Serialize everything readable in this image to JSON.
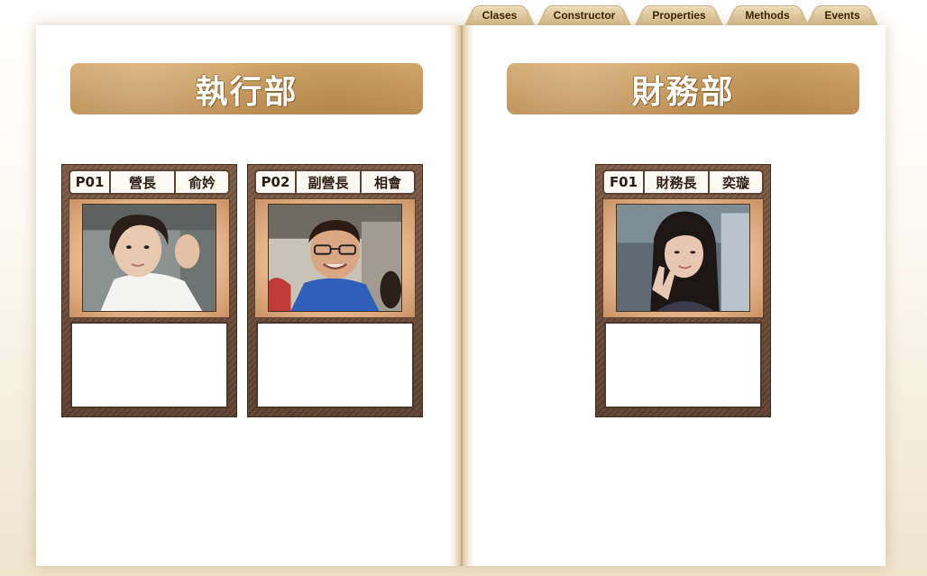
{
  "tabs": [
    {
      "label": "Clases"
    },
    {
      "label": "Constructor"
    },
    {
      "label": "Properties"
    },
    {
      "label": "Methods"
    },
    {
      "label": "Events"
    }
  ],
  "left_page": {
    "department": "執行部",
    "members": [
      {
        "id": "P01",
        "role": "營長",
        "name": "俞妗",
        "photo_icon": "member-photo"
      },
      {
        "id": "P02",
        "role": "副營長",
        "name": "相會",
        "photo_icon": "member-photo"
      }
    ]
  },
  "right_page": {
    "department": "財務部",
    "members": [
      {
        "id": "F01",
        "role": "財務長",
        "name": "奕璇",
        "photo_icon": "member-photo"
      }
    ]
  },
  "colors": {
    "banner": "#c79a5e",
    "card_frame": "#6b4a36",
    "tab": "#d6bd8e",
    "tab_text": "#3b2305"
  }
}
